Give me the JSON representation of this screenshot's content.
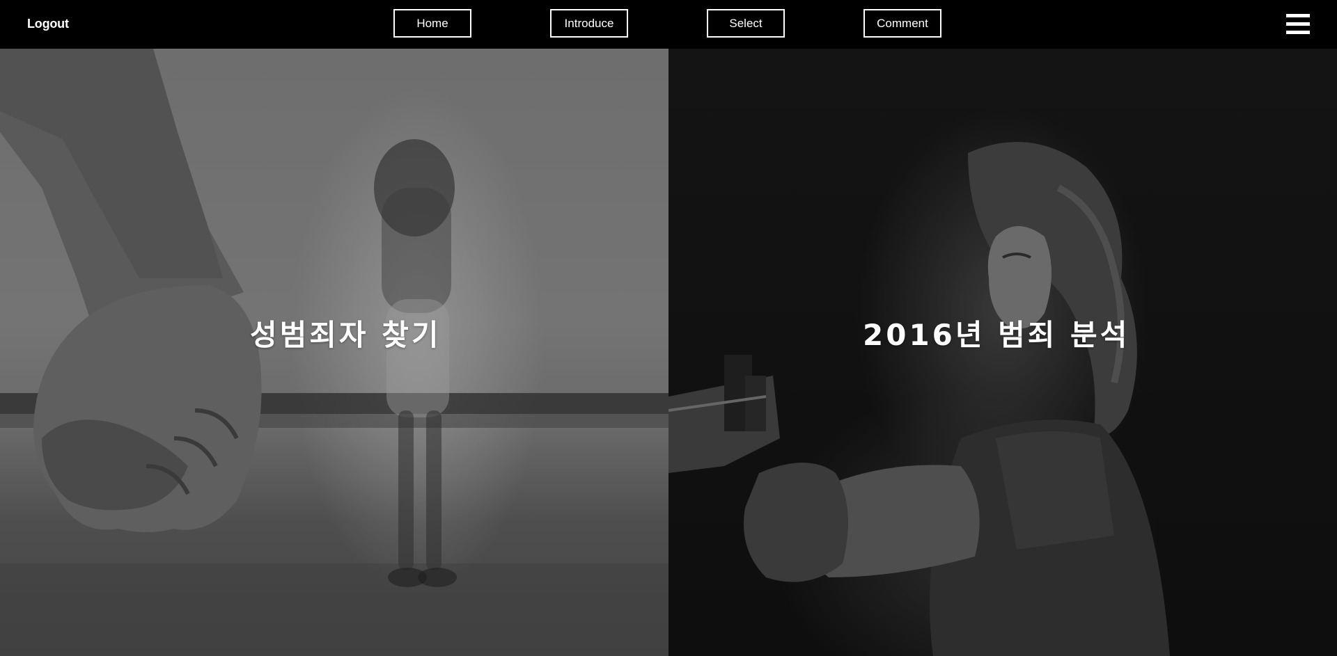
{
  "header": {
    "logout_label": "Logout",
    "nav": [
      {
        "label": "Home"
      },
      {
        "label": "Introduce"
      },
      {
        "label": "Select"
      },
      {
        "label": "Comment"
      }
    ],
    "menu_icon": "hamburger-menu-icon"
  },
  "panels": {
    "left": {
      "title": "성범죄자 찾기",
      "image": "fist-and-girl-photo"
    },
    "right": {
      "title": "2016년 범죄 분석",
      "image": "woman-with-gun-photo"
    }
  },
  "colors": {
    "nav_background": "#000000",
    "text": "#ffffff",
    "border": "#ffffff"
  }
}
